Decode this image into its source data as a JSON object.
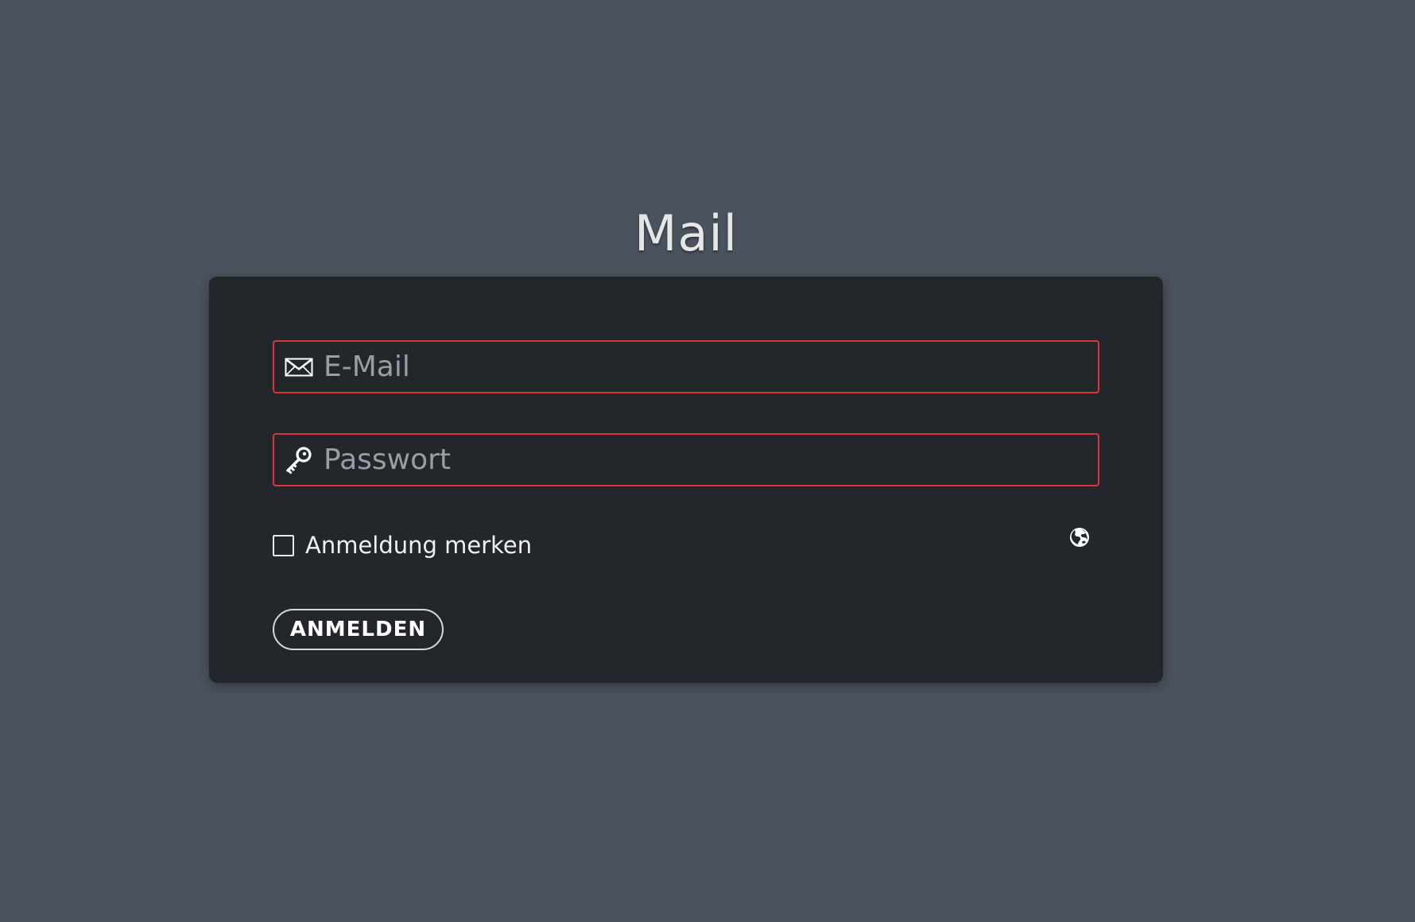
{
  "app": {
    "title": "Mail"
  },
  "login": {
    "email": {
      "placeholder": "E-Mail",
      "value": "",
      "icon": "envelope-icon"
    },
    "password": {
      "placeholder": "Passwort",
      "value": "",
      "icon": "key-icon"
    },
    "remember": {
      "label": "Anmeldung merken",
      "checked": false
    },
    "language": {
      "icon": "globe-icon"
    },
    "submit_label": "ANMELDEN"
  },
  "colors": {
    "page_background": "#4a535d",
    "card_background": "#23272c",
    "field_border_error": "#d9353a",
    "title_text": "#e6e6e6",
    "placeholder_text": "#9a9ea3",
    "button_border": "#d8d8d8"
  }
}
